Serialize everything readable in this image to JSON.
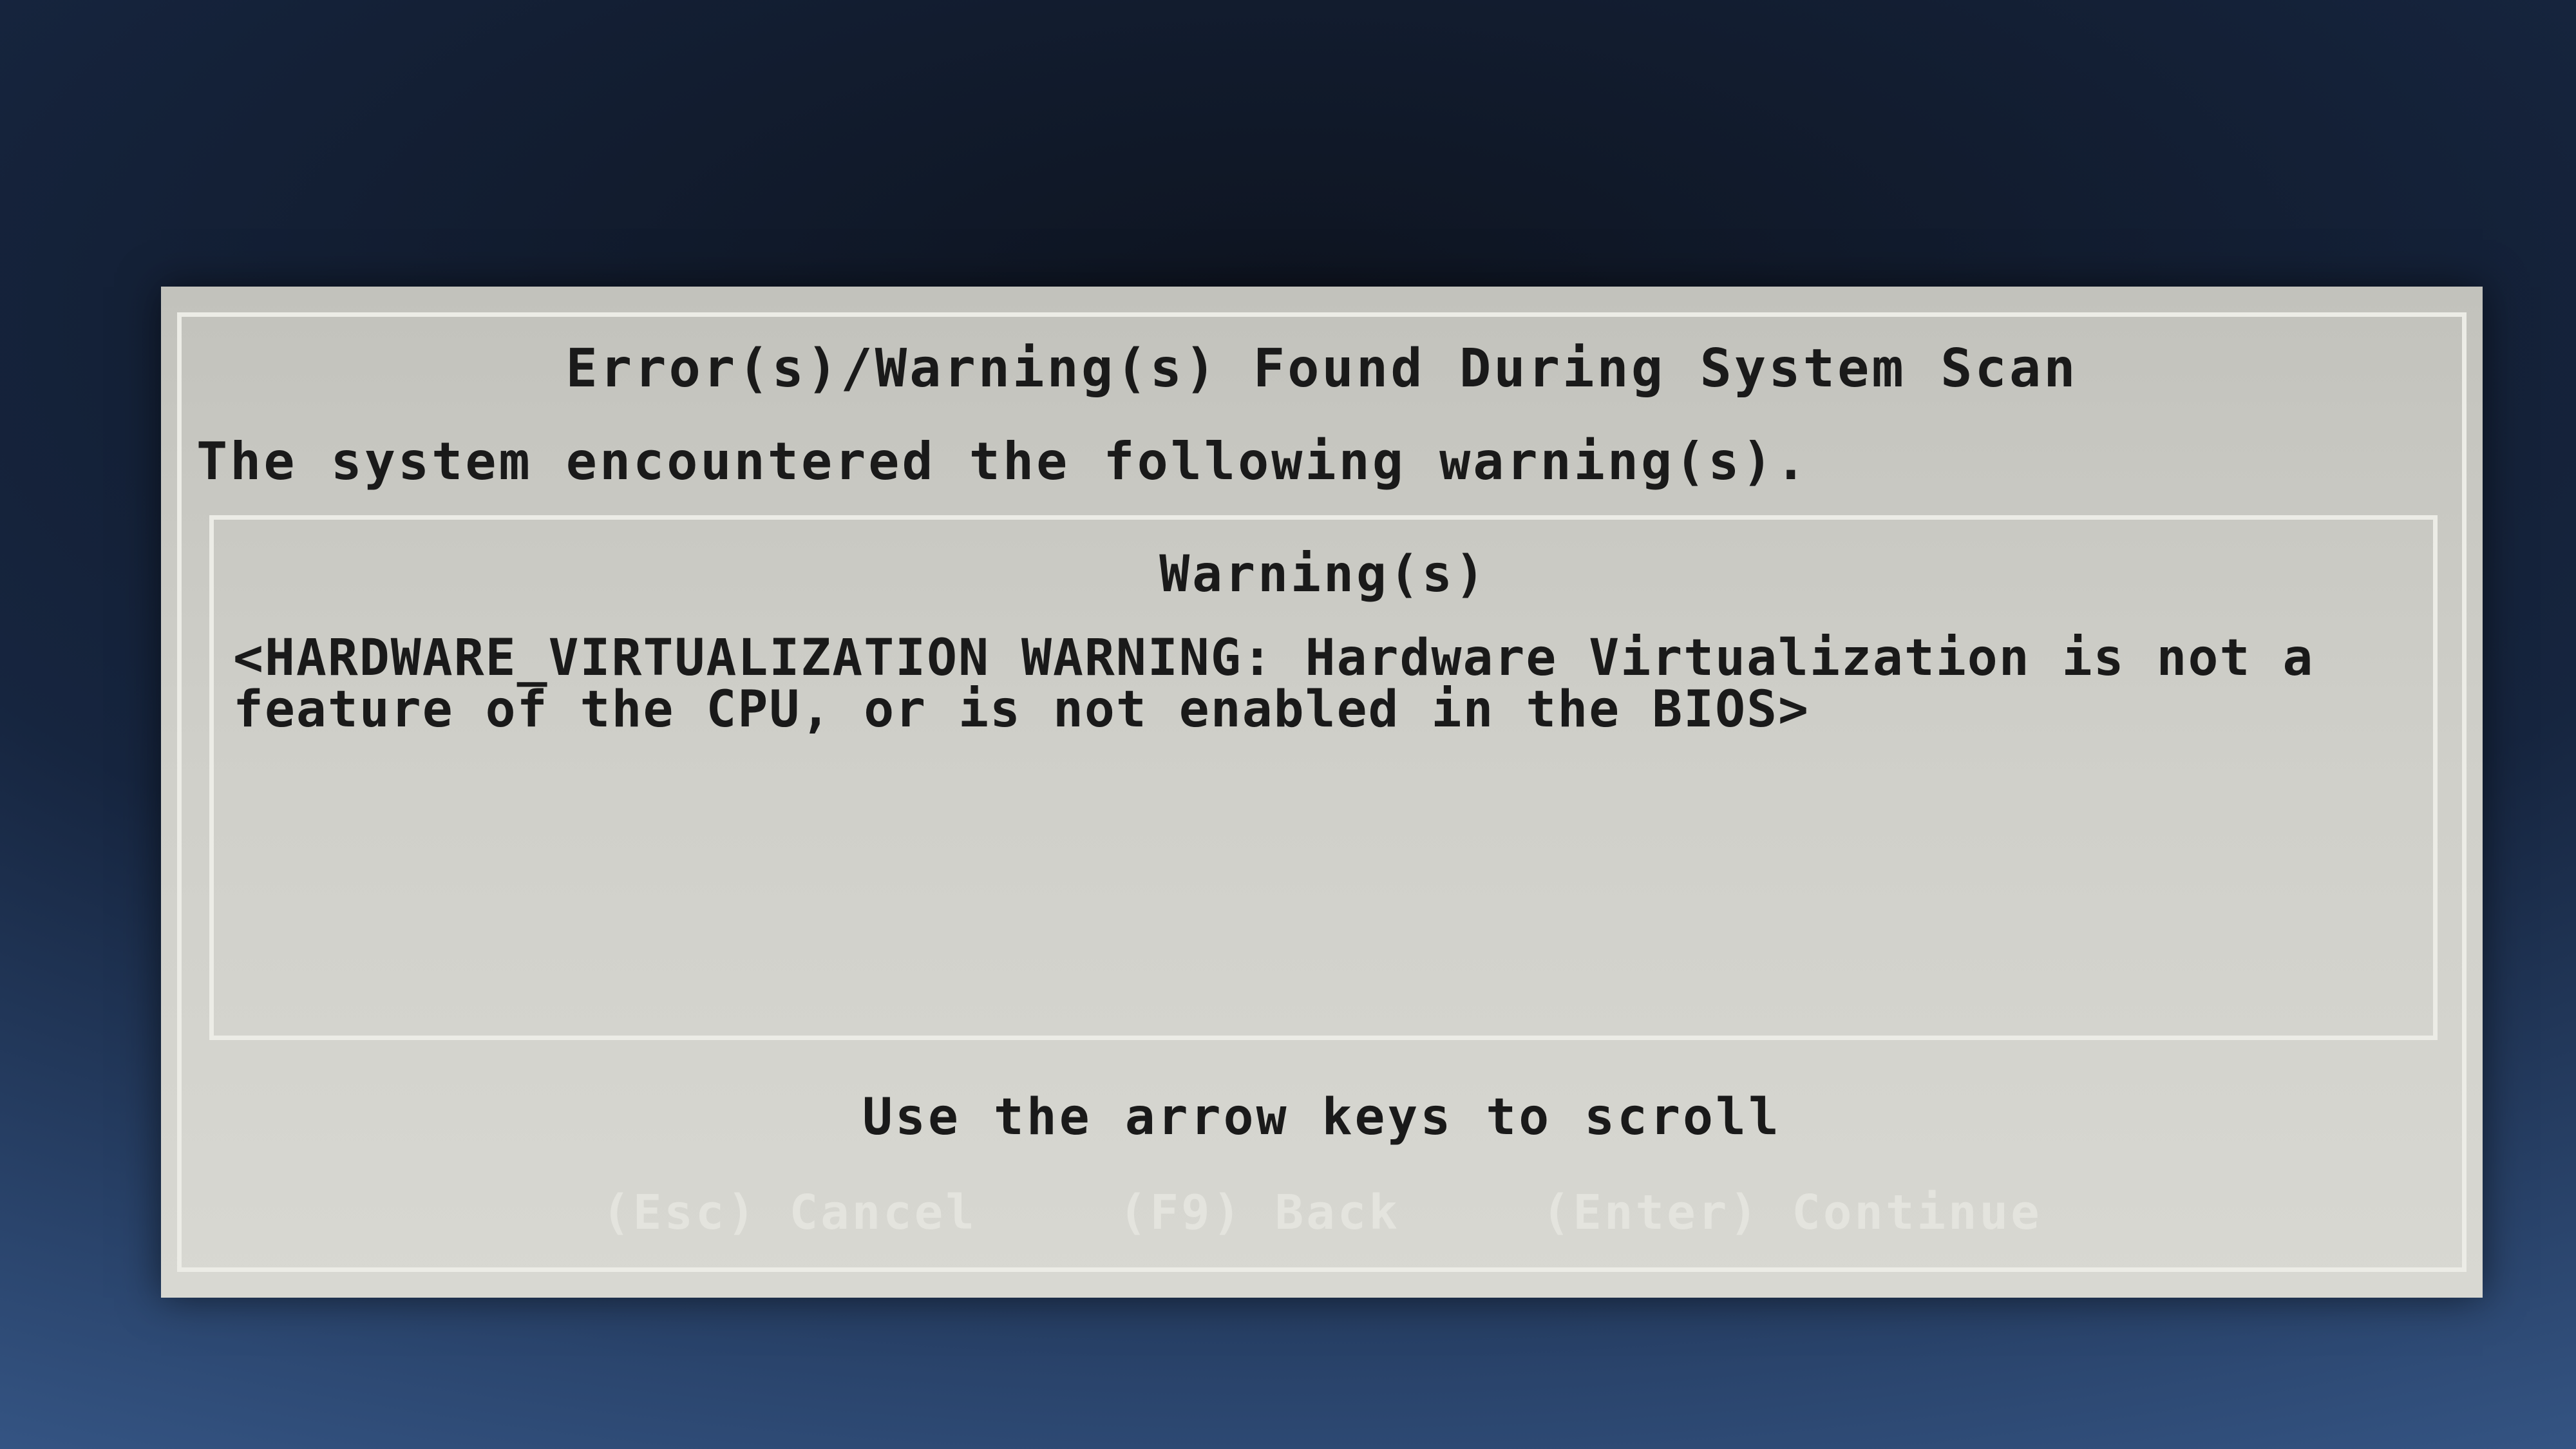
{
  "dialog": {
    "title": "Error(s)/Warning(s) Found During System Scan",
    "intro": "The system encountered the following warning(s).",
    "warnings_heading": "Warning(s)",
    "warnings": [
      "<HARDWARE_VIRTUALIZATION WARNING: Hardware Virtualization is not a feature of the CPU, or is not enabled in the BIOS>"
    ],
    "scroll_hint": "Use the arrow keys to scroll",
    "actions": {
      "cancel": "(Esc) Cancel",
      "back": "(F9) Back",
      "continue": "(Enter) Continue"
    }
  },
  "colors": {
    "dialog_background": "#cfcfc9",
    "text": "#1a1a1a",
    "frame": "#ececE6",
    "action_text": "#e4e4de",
    "screen_background": "#16253f"
  }
}
